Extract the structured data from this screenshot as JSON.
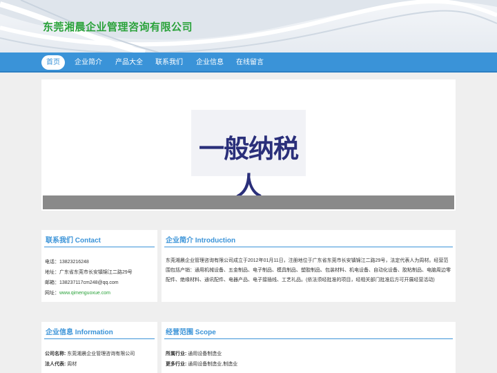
{
  "header": {
    "company_name": "东莞湘晨企业管理咨询有限公司"
  },
  "nav": {
    "items": [
      {
        "label": "首页",
        "active": true
      },
      {
        "label": "企业简介",
        "active": false
      },
      {
        "label": "产品大全",
        "active": false
      },
      {
        "label": "联系我们",
        "active": false
      },
      {
        "label": "企业信息",
        "active": false
      },
      {
        "label": "在线留言",
        "active": false
      }
    ]
  },
  "banner": {
    "image_text": "一般纳税人"
  },
  "contact": {
    "title": "联系我们 Contact",
    "phone": "电话：13823216248",
    "address": "地址：广东省东莞市长安镇锦江二路29号",
    "email": "邮箱：138237117cm248@qq.com",
    "website_label": "网址：",
    "website_url": "www.qimenguoxue.com"
  },
  "intro": {
    "title": "企业简介 Introduction",
    "text": "东莞湘晨企业管理咨询有限公司成立于2012年01月11日，注册地位于广东省东莞市长安镇锦江二路29号，法定代表人为周材。经营范围包括产销：通用机械设备、五金制品、电子制品、模具制品、塑胶制品、包装材料、机电设备、自动化设备、胶粘制品、电脑周边零配件、绝缘材料、通讯配件、电器产品、电子接插线、工艺礼品。(依法须经批准的项目，经相关部门批准后方可开展经营活动)"
  },
  "info": {
    "title": "企业信息 Information",
    "company_label": "公司名称:",
    "company_value": "东莞湘晨企业管理咨询有限公司",
    "legal_label": "法人代表:",
    "legal_value": "周材"
  },
  "scope": {
    "title": "经营范围 Scope",
    "industry_label": "所属行业:",
    "industry_value": "通用设备制造业",
    "more_label": "更多行业:",
    "more_value": "通用设备制造业,制造业"
  },
  "colors": {
    "accent": "#3a93d8",
    "brand_green": "#2aa23a"
  }
}
